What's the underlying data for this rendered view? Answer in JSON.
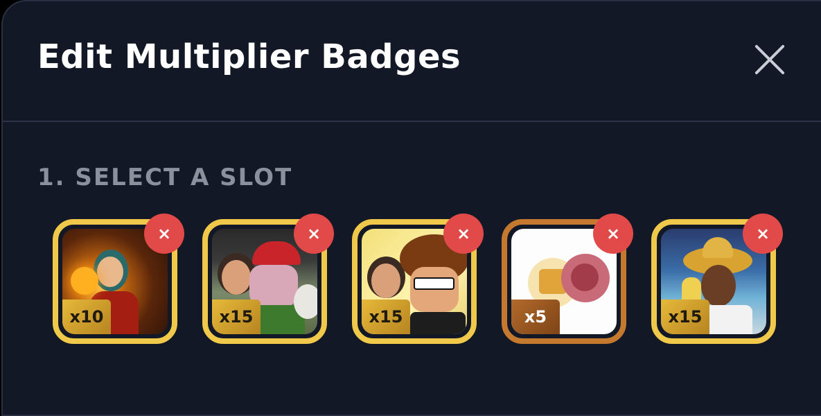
{
  "header": {
    "title": "Edit Multiplier Badges"
  },
  "section": {
    "label": "1. SELECT A SLOT"
  },
  "slots": [
    {
      "multiplier": "x10",
      "tier": "gold"
    },
    {
      "multiplier": "x15",
      "tier": "gold"
    },
    {
      "multiplier": "x15",
      "tier": "gold"
    },
    {
      "multiplier": "x5",
      "tier": "bronze"
    },
    {
      "multiplier": "x15",
      "tier": "gold"
    }
  ],
  "remove_label": "×",
  "colors": {
    "background": "#131826",
    "gold_border": "#f0c84a",
    "bronze_border": "#c5792f",
    "remove_badge": "#e24a4a",
    "label": "#8a909c"
  },
  "icons": {
    "close": "close-icon",
    "remove": "remove-icon"
  }
}
